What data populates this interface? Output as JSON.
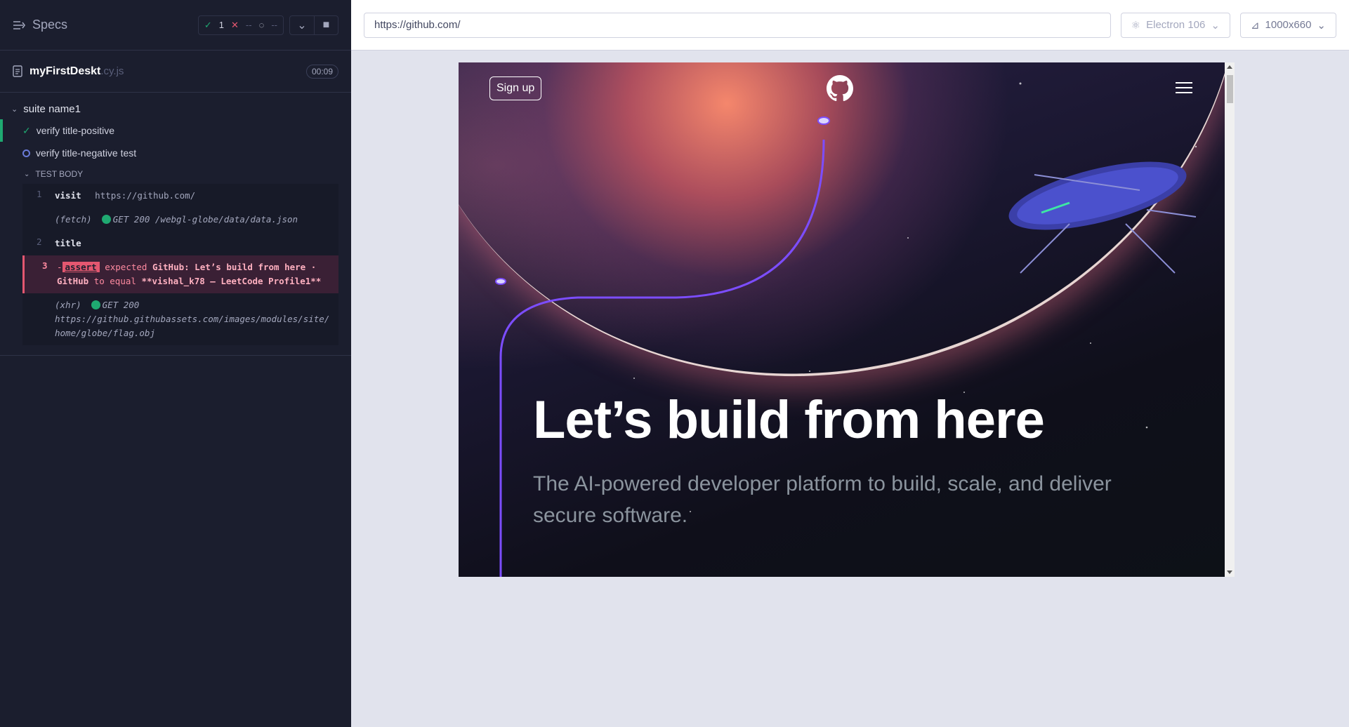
{
  "reporter": {
    "specs_label": "Specs",
    "stats": {
      "passed": "1",
      "failed": "--",
      "pending": "--"
    },
    "spec_file": {
      "name": "myFirstDeskt",
      "ext": ".cy.js",
      "duration": "00:09"
    },
    "suite": "suite name1",
    "tests": [
      {
        "title": "verify title-positive",
        "state": "passed"
      },
      {
        "title": "verify title-negative test",
        "state": "running"
      }
    ],
    "test_body_label": "TEST BODY",
    "commands": [
      {
        "num": "1",
        "name": "visit",
        "arg": "https://github.com/"
      },
      {
        "num": "",
        "name": "(fetch)",
        "method": "GET 200 /webgl-globe/data/data.json"
      },
      {
        "num": "2",
        "name": "title",
        "arg": ""
      },
      {
        "num": "3",
        "prefix": "-",
        "tag": "assert",
        "text1": "expected",
        "b1": "GitHub: Let’s build from here · GitHub",
        "text2": "to equal",
        "b2": "**vishal_k78 – LeetCode Profile1**"
      },
      {
        "num": "",
        "name": "(xhr)",
        "method": "GET 200",
        "url": "https://github.githubassets.com/images/modules/site/home/globe/flag.obj"
      }
    ]
  },
  "aut": {
    "url": "https://github.com/",
    "browser": "Electron 106",
    "viewport_size": "1000x660",
    "page": {
      "signup": "Sign up",
      "headline": "Let’s build from here",
      "subhead": "The AI-powered developer platform to build, scale, and deliver secure software."
    }
  }
}
